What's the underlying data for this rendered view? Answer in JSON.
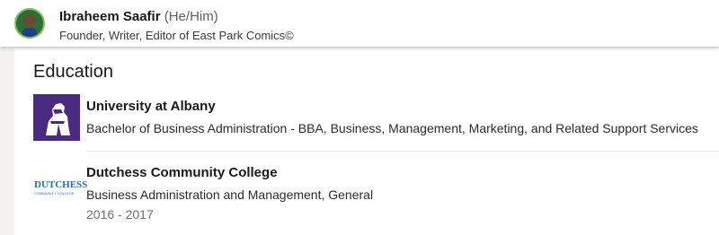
{
  "header": {
    "name": "Ibraheem Saafir",
    "pronouns": "(He/Him)",
    "headline": "Founder, Writer, Editor of East Park Comics©",
    "avatar_icon": "profile-photo"
  },
  "education": {
    "title": "Education",
    "entries": [
      {
        "school": "University at Albany",
        "degree": "Bachelor of Business Administration - BBA, Business, Management, Marketing, and Related Support Services",
        "dates": "",
        "logo_color": "#4b2a82",
        "logo_icon": "minerva-logo"
      },
      {
        "school": "Dutchess Community College",
        "degree": "Business Administration and Management, General",
        "dates": "2016 - 2017",
        "logo_text": "DUTCHESS",
        "logo_subtext": "COMMUNITY COLLEGE",
        "logo_color": "#2a6db0"
      }
    ]
  }
}
